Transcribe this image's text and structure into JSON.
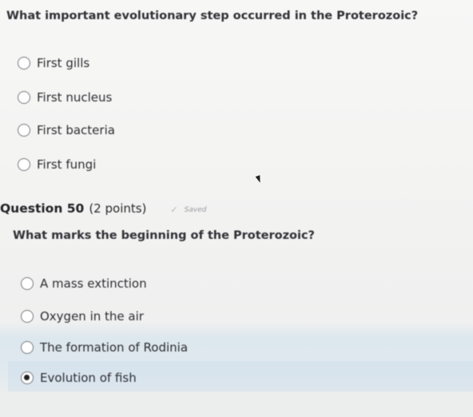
{
  "questions": [
    {
      "prompt": "What important evolutionary step occurred in the Proterozoic?",
      "options": [
        {
          "label": "First gills",
          "selected": false
        },
        {
          "label": "First nucleus",
          "selected": false
        },
        {
          "label": "First bacteria",
          "selected": false
        },
        {
          "label": "First fungi",
          "selected": false
        }
      ]
    },
    {
      "title": "Question 50",
      "points": "(2 points)",
      "status": "Saved",
      "status_icon": "checkmark-icon",
      "prompt": "What marks the beginning of the Proterozoic?",
      "options": [
        {
          "label": "A mass extinction",
          "selected": false
        },
        {
          "label": "Oxygen in the air",
          "selected": false
        },
        {
          "label": "The formation of Rodinia",
          "selected": false
        },
        {
          "label": "Evolution of fish",
          "selected": true
        }
      ]
    }
  ],
  "colors": {
    "selection_highlight": "#d6e4ee",
    "text": "#2f2f33",
    "saved_text": "#9a9a9f"
  }
}
